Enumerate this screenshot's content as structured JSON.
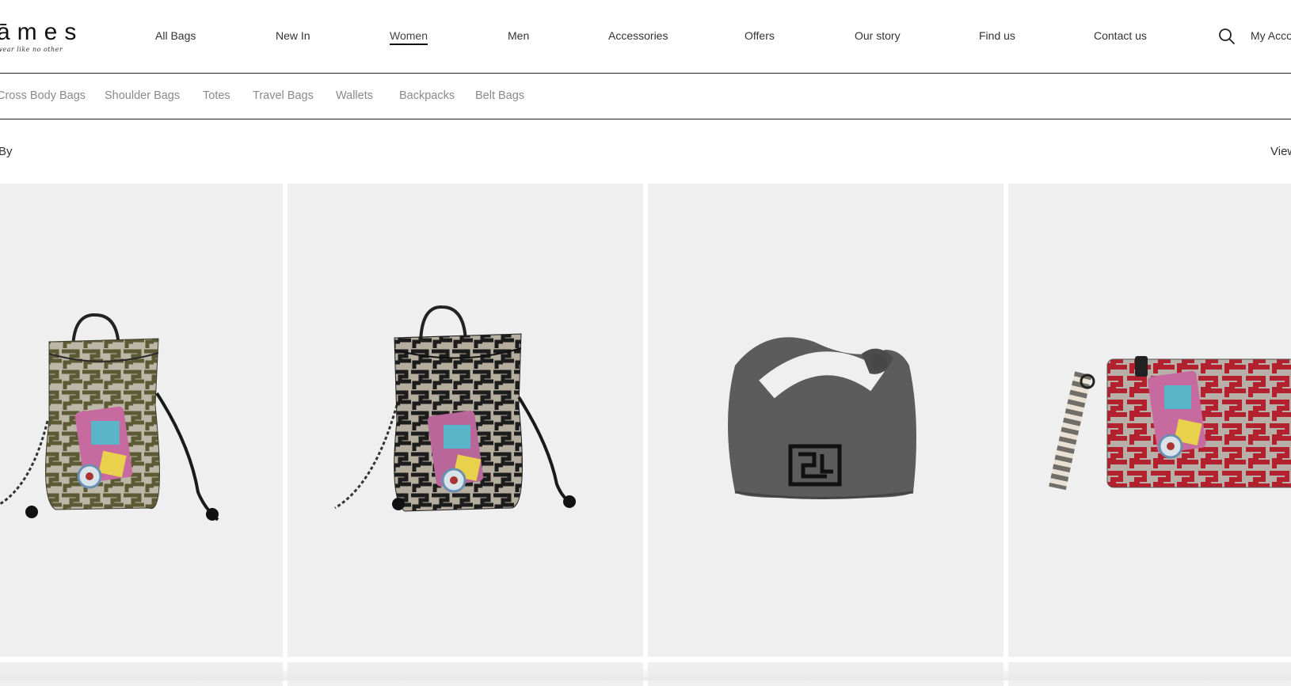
{
  "brand": {
    "logo_text": "āmes",
    "tagline": "wear like no other"
  },
  "main_nav": [
    {
      "label": "All Bags",
      "active": false
    },
    {
      "label": "New In",
      "active": false
    },
    {
      "label": "Women",
      "active": true
    },
    {
      "label": "Men",
      "active": false
    },
    {
      "label": "Accessories",
      "active": false
    },
    {
      "label": "Offers",
      "active": false
    },
    {
      "label": "Our story",
      "active": false
    },
    {
      "label": "Find us",
      "active": false
    },
    {
      "label": "Contact us",
      "active": false
    }
  ],
  "header_icons": {
    "search": "search-icon"
  },
  "account_label": "My Acco",
  "sub_nav": [
    "Cross Body Bags",
    "Shoulder Bags",
    "Totes",
    "Travel Bags",
    "Wallets",
    "Backpacks",
    "Belt Bags"
  ],
  "toolbar": {
    "sort_label": "By",
    "view_label": "View"
  },
  "products": [
    {
      "image": "patterned-bucket-bag-olive"
    },
    {
      "image": "patterned-bucket-bag-black"
    },
    {
      "image": "grey-knot-hobo-bag"
    },
    {
      "image": "red-maze-pouch-wristlet"
    }
  ],
  "colors": {
    "card_bg": "#efefef",
    "divider": "#222222",
    "subnav_text": "#8a8a8a"
  }
}
